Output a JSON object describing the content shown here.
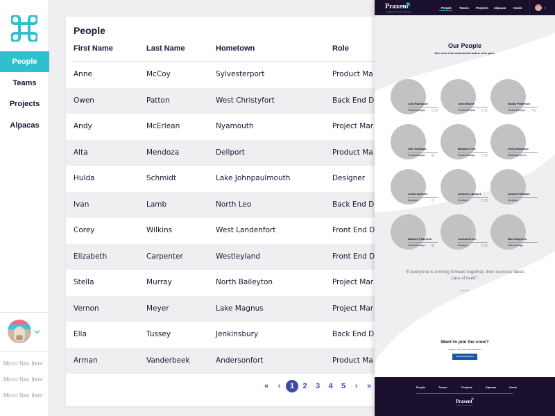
{
  "sidebar": {
    "logo_icon": "command-key-icon",
    "accent": "#2ec0cf",
    "nav": [
      {
        "label": "People",
        "active": true
      },
      {
        "label": "Teams",
        "active": false
      },
      {
        "label": "Projects",
        "active": false
      },
      {
        "label": "Alpacas",
        "active": false
      }
    ],
    "user": {
      "avatar": "alpaca-avatar",
      "menu_icon": "chevron-down-icon"
    },
    "micro_nav": [
      "Micro Nav Item",
      "Micro Nav Item",
      "Micro Nav Item"
    ]
  },
  "table": {
    "title": "People",
    "columns": [
      "First Name",
      "Last Name",
      "Hometown",
      "Role"
    ],
    "rows": [
      [
        "Anne",
        "McCoy",
        "Sylvesterport",
        "Product Ma"
      ],
      [
        "Owen",
        "Patton",
        "West Christyfort",
        "Back End D"
      ],
      [
        "Andy",
        "McErlean",
        "Nyamouth",
        "Project Mar"
      ],
      [
        "Alta",
        "Mendoza",
        "Dellport",
        "Product Ma"
      ],
      [
        "Hulda",
        "Schmidt",
        "Lake Johnpaulmouth",
        "Designer"
      ],
      [
        "Ivan",
        "Lamb",
        "North Leo",
        "Back End D"
      ],
      [
        "Corey",
        "Wilkins",
        "West Landenfort",
        "Front End D"
      ],
      [
        "Elizabeth",
        "Carpenter",
        "Westleyland",
        "Front End D"
      ],
      [
        "Stella",
        "Murray",
        "North Baileyton",
        "Project Mar"
      ],
      [
        "Vernon",
        "Meyer",
        "Lake Magnus",
        "Project Mar"
      ],
      [
        "Ella",
        "Tussey",
        "Jenkinsbury",
        "Back End D"
      ],
      [
        "Arman",
        "Vanderbeek",
        "Andersonfort",
        "Product Ma"
      ]
    ],
    "pagination": {
      "first": "«",
      "prev": "‹",
      "pages": [
        "1",
        "2",
        "3",
        "4",
        "5"
      ],
      "current": "1",
      "next": "›",
      "last": "»",
      "color": "#3e4aa6"
    }
  },
  "preview": {
    "brand": "Praxent",
    "brand_mark": "✖",
    "brand_tagline": "A Digital Innovation Agency",
    "nav": [
      "People",
      "Teams",
      "Projects",
      "Alpacas",
      "Goals"
    ],
    "active_nav": "People",
    "title": "Our People",
    "subtitle": "Meet some of the most talented makers in the game.",
    "people": [
      {
        "name": "Lola Rodriguez",
        "role": "Product Designer",
        "icons": "▢ ◫"
      },
      {
        "name": "Jared Meyer",
        "role": "Product Designer",
        "icons": "▢ ◫"
      },
      {
        "name": "Bobby Patterson",
        "role": "Product Designer",
        "icons": "f ◫"
      },
      {
        "name": "Allie Santiago",
        "role": "Product Manager",
        "icons": "◫"
      },
      {
        "name": "Margaret Cox",
        "role": "Product Manager",
        "icons": "▢ ◫"
      },
      {
        "name": "Emily Sandoval",
        "role": "Marketing Director",
        "icons": ""
      },
      {
        "name": "Luella Spencer",
        "role": "Developer",
        "icons": "▢"
      },
      {
        "name": "Anthony Lambert",
        "role": "Developer",
        "icons": "▢ ◫"
      },
      {
        "name": "Antonio Webster",
        "role": "Developer",
        "icons": ""
      },
      {
        "name": "Mabelle Patterson",
        "role": "Product Manager",
        "icons": "◫"
      },
      {
        "name": "Joshua Green",
        "role": "Developer",
        "icons": "▢ ◫"
      },
      {
        "name": "Max Stephens",
        "role": "Office Manager",
        "icons": ""
      }
    ],
    "quote": "“If everyone is moving forward together, then success takes care of itself.”",
    "quote_author": "Henry Ford",
    "join_title": "Want to join the crew?",
    "join_sub": "Apply for one of our open positions!",
    "join_button": "View All Positions",
    "footer_nav": [
      "People",
      "Teams",
      "Projects",
      "Alpacas",
      "Goals"
    ],
    "footer_brand": "Praxent",
    "footer_tagline": "A Digital Innovation Agency",
    "dark_color": "#1b0f2e",
    "button_color": "#1a56a8"
  }
}
